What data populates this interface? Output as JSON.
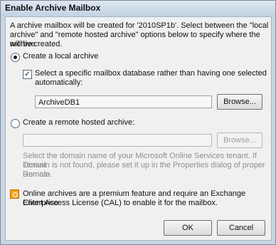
{
  "window": {
    "title": "Enable Archive Mailbox"
  },
  "intro": {
    "line1": "A archive mailbox will be created for '2010SP1b'. Select between the \"local",
    "line2": "archive\" and \"remote hosted archive\" options below to specify where the archive",
    "line3": "will be created."
  },
  "local": {
    "radio_label": "Create a local archive",
    "selected": true,
    "checkbox_line1": "Select a specific mailbox database rather than having one selected",
    "checkbox_line2": "automatically:",
    "checked": true,
    "database_value": "ArchiveDB1",
    "browse_label": "Browse..."
  },
  "remote": {
    "radio_label": "Create a remote hosted archive:",
    "selected": false,
    "value": "",
    "browse_label": "Browse...",
    "help_line1": "Select the domain name of your Microsoft Online Services tenant. If Tenant",
    "help_line2": "Domain is not found, please set it up in the Properties dialog of proper Remote",
    "help_line3": "Domain."
  },
  "notice": {
    "line1": "Online archives are a premium feature and require an Exchange Enterprise",
    "line2": "Client Access License (CAL) to enable it for the mailbox."
  },
  "buttons": {
    "ok": "OK",
    "cancel": "Cancel"
  },
  "colors": {
    "warning": "#f7a21b",
    "titlebar": "#c3d2e2"
  }
}
